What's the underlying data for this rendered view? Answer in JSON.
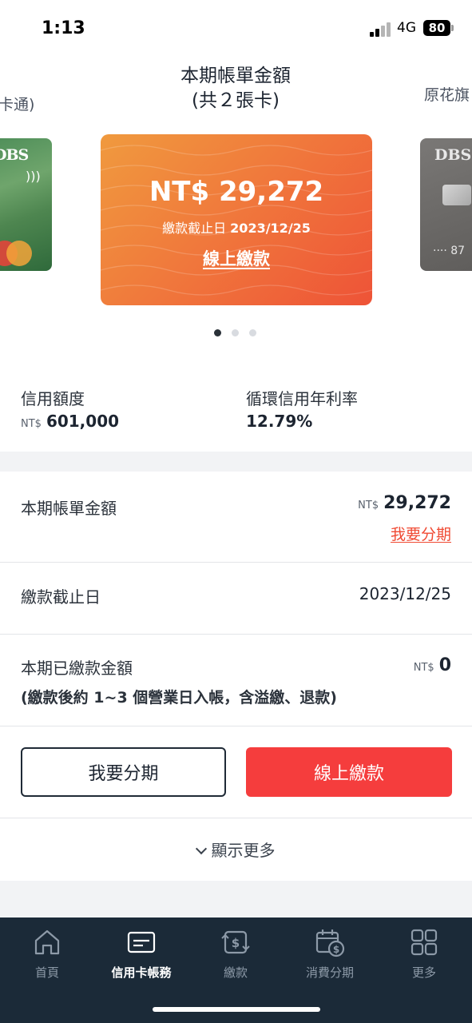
{
  "status_bar": {
    "time": "1:13",
    "network": "4G",
    "battery": "80"
  },
  "carousel": {
    "title_line1": "本期帳單金額",
    "title_line2": "(共２張卡)",
    "left_card_label": "卡通)",
    "right_card_label": "原花旗",
    "left_card_brand": "DBS",
    "right_card_brand": "DBS",
    "right_card_number": "···· 87",
    "active_index": 0,
    "total_pages": 3
  },
  "bill_card": {
    "amount": "NT$ 29,272",
    "due_label": "繳款截止日",
    "due_date": "2023/12/25",
    "pay_link": "線上繳款"
  },
  "credit_info": {
    "limit_label": "信用額度",
    "limit_currency": "NT$",
    "limit_value": "601,000",
    "rate_label": "循環信用年利率",
    "rate_value": "12.79%"
  },
  "details": {
    "statement_label": "本期帳單金額",
    "statement_currency": "NT$",
    "statement_value": "29,272",
    "installment_link": "我要分期",
    "due_label": "繳款截止日",
    "due_value": "2023/12/25",
    "paid_label": "本期已繳款金額",
    "paid_currency": "NT$",
    "paid_value": "0",
    "paid_note": "(繳款後約 1~3 個營業日入帳，含溢繳、退款)"
  },
  "buttons": {
    "installment": "我要分期",
    "pay_online": "線上繳款"
  },
  "show_more": "顯示更多",
  "bottom_nav": {
    "items": [
      {
        "label": "首頁",
        "icon": "home-icon"
      },
      {
        "label": "信用卡帳務",
        "icon": "credit-card-icon"
      },
      {
        "label": "繳款",
        "icon": "payment-exchange-icon"
      },
      {
        "label": "消費分期",
        "icon": "calendar-dollar-icon"
      },
      {
        "label": "更多",
        "icon": "grid-icon"
      }
    ],
    "active_index": 1
  },
  "colors": {
    "accent_red": "#f53d3d",
    "link_orange": "#f04a33",
    "nav_background": "#1b2a38",
    "card_gradient_start": "#f09a3e",
    "card_gradient_end": "#ee5337"
  }
}
